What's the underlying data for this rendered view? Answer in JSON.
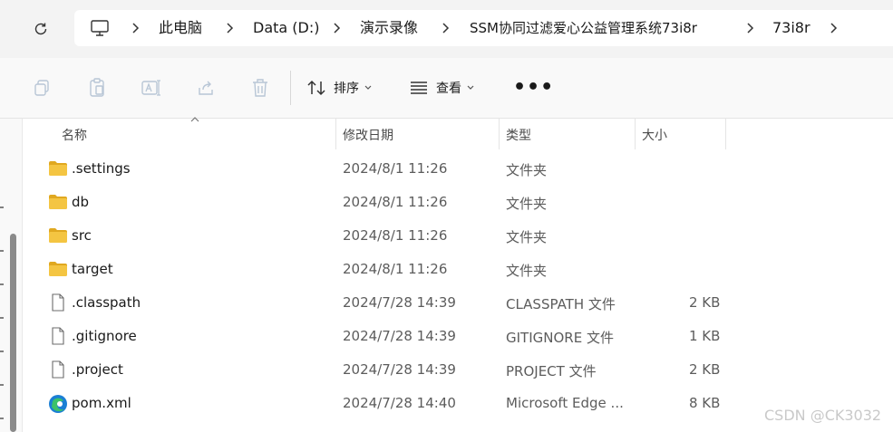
{
  "breadcrumb": {
    "items": [
      "此电脑",
      "Data (D:)",
      "演示录像",
      "SSM协同过滤爱心公益管理系统73i8r",
      "73i8r"
    ]
  },
  "toolbar": {
    "sort_label": "排序",
    "view_label": "查看",
    "more_label": "•••"
  },
  "columns": {
    "name": "名称",
    "modified": "修改日期",
    "type": "类型",
    "size": "大小"
  },
  "files": [
    {
      "name": ".settings",
      "modified": "2024/8/1 11:26",
      "type": "文件夹",
      "size": "",
      "icon": "folder-icon"
    },
    {
      "name": "db",
      "modified": "2024/8/1 11:26",
      "type": "文件夹",
      "size": "",
      "icon": "folder-icon"
    },
    {
      "name": "src",
      "modified": "2024/8/1 11:26",
      "type": "文件夹",
      "size": "",
      "icon": "folder-icon"
    },
    {
      "name": "target",
      "modified": "2024/8/1 11:26",
      "type": "文件夹",
      "size": "",
      "icon": "folder-icon"
    },
    {
      "name": ".classpath",
      "modified": "2024/7/28 14:39",
      "type": "CLASSPATH 文件",
      "size": "2 KB",
      "icon": "file-icon"
    },
    {
      "name": ".gitignore",
      "modified": "2024/7/28 14:39",
      "type": "GITIGNORE 文件",
      "size": "1 KB",
      "icon": "file-icon"
    },
    {
      "name": ".project",
      "modified": "2024/7/28 14:39",
      "type": "PROJECT 文件",
      "size": "2 KB",
      "icon": "file-icon"
    },
    {
      "name": "pom.xml",
      "modified": "2024/7/28 14:40",
      "type": "Microsoft Edge ...",
      "size": "8 KB",
      "icon": "edge-icon"
    }
  ],
  "watermark": "CSDN @CK3032",
  "colors": {
    "folder": "#f4c542",
    "folder_dark": "#e0a820",
    "edge_blue": "#1b7fd4",
    "edge_green": "#3cc26a"
  }
}
